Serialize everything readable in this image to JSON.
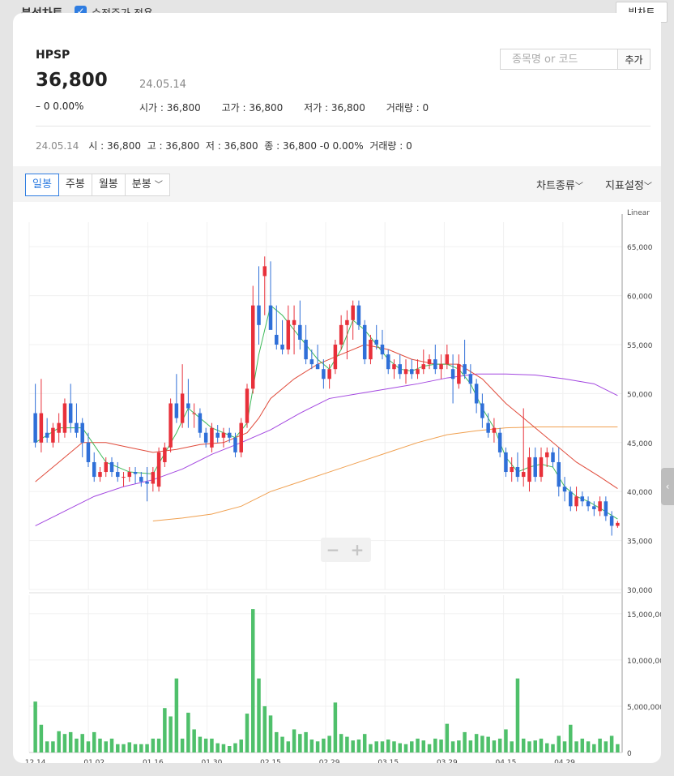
{
  "topbar": {
    "title": "분석차트",
    "adjusted_label": "수정주가 적용",
    "big_chart_btn": "빅차트"
  },
  "header": {
    "symbol": "HPSP",
    "price": "36,800",
    "date": "24.05.14",
    "change": "0",
    "change_pct": "0.00%",
    "open": "시가 : 36,800",
    "high": "고가 : 36,800",
    "low": "저가 : 36,800",
    "volume": "거래량 : 0",
    "search_placeholder": "종목명 or 코드",
    "add_label": "추가"
  },
  "ohlc_line": {
    "date": "24.05.14",
    "text": "시 : 36,800  고 : 36,800  저 : 36,800  종 : 36,800 -0 0.00%  거래량 : 0"
  },
  "toolbar": {
    "tabs": [
      "일봉",
      "주봉",
      "월봉",
      "분봉"
    ],
    "active_tab": 0,
    "chart_type": "차트종류",
    "indicator": "지표설정"
  },
  "colors": {
    "up": "#e8303a",
    "down": "#2f6fd8",
    "volume": "#4fc06b",
    "ma5": "#3fba5a",
    "ma20": "#e04a3a",
    "ma60": "#a347e0",
    "ma120": "#f0a050",
    "accent": "#2f7de1"
  },
  "chart_data": {
    "type": "candlestick",
    "scale_label": "Linear",
    "y_ticks": [
      30000,
      35000,
      40000,
      45000,
      50000,
      55000,
      60000,
      65000
    ],
    "ylim": [
      30000,
      67500
    ],
    "vol_ticks": [
      0,
      5000000,
      10000000,
      15000000
    ],
    "vol_max": 17000000,
    "x_labels": [
      "12.14",
      "01.02",
      "01.16",
      "01.30",
      "02.15",
      "02.29",
      "03.15",
      "03.29",
      "04.15",
      "04.29"
    ],
    "x_label_idx": [
      0,
      10,
      20,
      30,
      40,
      50,
      60,
      70,
      80,
      90
    ],
    "candles": [
      [
        48000,
        51000,
        44500,
        45000,
        5500000
      ],
      [
        45000,
        51500,
        44000,
        48000,
        3000000
      ],
      [
        46000,
        47500,
        45000,
        45500,
        1200000
      ],
      [
        45000,
        47000,
        44500,
        46500,
        1200000
      ],
      [
        46000,
        48000,
        45000,
        47000,
        2300000
      ],
      [
        46000,
        49500,
        45500,
        49000,
        2000000
      ],
      [
        49000,
        51000,
        46000,
        47000,
        2200000
      ],
      [
        47000,
        49000,
        45500,
        46000,
        1500000
      ],
      [
        47000,
        47500,
        43500,
        45000,
        2000000
      ],
      [
        45000,
        46000,
        42500,
        43000,
        1200000
      ],
      [
        43000,
        44000,
        41000,
        41500,
        2200000
      ],
      [
        41500,
        42500,
        41000,
        42000,
        1500000
      ],
      [
        42000,
        43500,
        41500,
        43000,
        1200000
      ],
      [
        43000,
        43500,
        41500,
        42000,
        1500000
      ],
      [
        42000,
        43000,
        41000,
        41500,
        900000
      ],
      [
        41500,
        42000,
        40500,
        41500,
        900000
      ],
      [
        41500,
        42500,
        41000,
        42000,
        1100000
      ],
      [
        42000,
        42500,
        40800,
        41800,
        900000
      ],
      [
        41500,
        42000,
        40500,
        41000,
        900000
      ],
      [
        41000,
        42500,
        39000,
        40800,
        900000
      ],
      [
        40800,
        42500,
        40000,
        42000,
        1500000
      ],
      [
        40500,
        44500,
        40000,
        44000,
        1500000
      ],
      [
        43000,
        45000,
        42500,
        44500,
        4800000
      ],
      [
        44500,
        49500,
        44000,
        49000,
        3900000
      ],
      [
        49000,
        52000,
        47000,
        47500,
        8000000
      ],
      [
        47000,
        53000,
        46500,
        50000,
        1500000
      ],
      [
        49000,
        51500,
        46500,
        48500,
        4300000
      ],
      [
        48000,
        49000,
        46500,
        48000,
        2500000
      ],
      [
        48000,
        48500,
        45500,
        46000,
        1700000
      ],
      [
        46000,
        46500,
        44500,
        45000,
        1500000
      ],
      [
        44500,
        47000,
        44000,
        46500,
        1500000
      ],
      [
        46000,
        46800,
        45000,
        45500,
        1000000
      ],
      [
        45500,
        46500,
        44500,
        46000,
        900000
      ],
      [
        46000,
        46500,
        45000,
        45500,
        700000
      ],
      [
        45500,
        46000,
        43500,
        44000,
        1000000
      ],
      [
        44000,
        47500,
        43500,
        47000,
        1400000
      ],
      [
        47000,
        51000,
        46500,
        50500,
        4200000
      ],
      [
        50500,
        61000,
        50000,
        59000,
        15500000
      ],
      [
        59000,
        63000,
        55000,
        57000,
        8000000
      ],
      [
        62000,
        64000,
        58000,
        63000,
        5000000
      ],
      [
        59000,
        63500,
        57000,
        56500,
        4000000
      ],
      [
        56000,
        59000,
        54500,
        55000,
        2200000
      ],
      [
        55000,
        57500,
        54000,
        54500,
        1700000
      ],
      [
        54500,
        59000,
        54000,
        57500,
        1200000
      ],
      [
        57000,
        59000,
        54000,
        57500,
        2500000
      ],
      [
        57000,
        59500,
        54500,
        55500,
        2000000
      ],
      [
        55500,
        57000,
        53000,
        53500,
        2200000
      ],
      [
        53500,
        54500,
        52500,
        53000,
        1400000
      ],
      [
        53000,
        55000,
        52500,
        52500,
        1200000
      ],
      [
        52500,
        53500,
        50500,
        51500,
        1500000
      ],
      [
        51500,
        53000,
        50500,
        52500,
        1800000
      ],
      [
        52500,
        55500,
        52000,
        55000,
        5400000
      ],
      [
        55000,
        58000,
        54500,
        57000,
        2000000
      ],
      [
        57000,
        58500,
        53500,
        57500,
        1700000
      ],
      [
        57500,
        59500,
        55500,
        59000,
        1300000
      ],
      [
        59000,
        59500,
        56500,
        57000,
        1400000
      ],
      [
        57000,
        57500,
        53000,
        53500,
        2000000
      ],
      [
        53500,
        56000,
        53000,
        55500,
        900000
      ],
      [
        55500,
        57000,
        54500,
        55000,
        1200000
      ],
      [
        55000,
        56500,
        53500,
        54000,
        1200000
      ],
      [
        54000,
        54500,
        52000,
        52500,
        1400000
      ],
      [
        52500,
        53500,
        51500,
        53000,
        1200000
      ],
      [
        53000,
        54000,
        51500,
        52000,
        1000000
      ],
      [
        52000,
        53500,
        51000,
        52500,
        900000
      ],
      [
        52500,
        53500,
        51500,
        52000,
        1200000
      ],
      [
        52000,
        53500,
        51500,
        52500,
        1500000
      ],
      [
        52500,
        54500,
        52000,
        53000,
        1300000
      ],
      [
        53000,
        54000,
        52500,
        53500,
        900000
      ],
      [
        53500,
        55000,
        52000,
        52500,
        1500000
      ],
      [
        52500,
        54000,
        51500,
        53000,
        1400000
      ],
      [
        53000,
        55000,
        52500,
        54000,
        3100000
      ],
      [
        52500,
        54000,
        49000,
        51500,
        1200000
      ],
      [
        51000,
        54000,
        50500,
        53000,
        1300000
      ],
      [
        53000,
        55500,
        51500,
        52000,
        2200000
      ],
      [
        52000,
        53000,
        50000,
        51000,
        1300000
      ],
      [
        51000,
        51500,
        48000,
        49000,
        2000000
      ],
      [
        49000,
        50000,
        46500,
        47500,
        1800000
      ],
      [
        47000,
        48000,
        45500,
        46000,
        1700000
      ],
      [
        46000,
        47500,
        45000,
        46500,
        1300000
      ],
      [
        46000,
        46500,
        43500,
        44000,
        1500000
      ],
      [
        44000,
        44500,
        41500,
        42000,
        2500000
      ],
      [
        42000,
        43500,
        41000,
        42500,
        1200000
      ],
      [
        42500,
        44000,
        41000,
        41500,
        8000000
      ],
      [
        41500,
        48500,
        40500,
        42000,
        1500000
      ],
      [
        41000,
        44500,
        40000,
        43500,
        1200000
      ],
      [
        43500,
        44500,
        41000,
        41500,
        1300000
      ],
      [
        41500,
        44500,
        41000,
        43500,
        1500000
      ],
      [
        43500,
        44500,
        42500,
        44000,
        1000000
      ],
      [
        44000,
        44500,
        42500,
        43000,
        900000
      ],
      [
        43000,
        44500,
        39500,
        40500,
        1800000
      ],
      [
        40500,
        41500,
        39000,
        40000,
        1200000
      ],
      [
        40000,
        40500,
        38000,
        38500,
        3000000
      ],
      [
        38500,
        40500,
        38000,
        39500,
        1200000
      ],
      [
        39500,
        40000,
        38500,
        39000,
        1500000
      ],
      [
        39000,
        39500,
        38000,
        38500,
        1200000
      ],
      [
        38500,
        39000,
        37500,
        38200,
        900000
      ],
      [
        38000,
        39500,
        37500,
        39000,
        1500000
      ],
      [
        39000,
        39500,
        37000,
        37500,
        1200000
      ],
      [
        37500,
        38000,
        35500,
        36500,
        1800000
      ],
      [
        36500,
        37000,
        36300,
        36800,
        900000
      ]
    ],
    "ma5": [
      [
        0,
        45000
      ],
      [
        4,
        46500
      ],
      [
        8,
        46500
      ],
      [
        12,
        43000
      ],
      [
        16,
        42000
      ],
      [
        20,
        41800
      ],
      [
        24,
        46000
      ],
      [
        26,
        48500
      ],
      [
        30,
        46500
      ],
      [
        34,
        45500
      ],
      [
        36,
        47000
      ],
      [
        38,
        54000
      ],
      [
        40,
        59000
      ],
      [
        42,
        58000
      ],
      [
        44,
        56500
      ],
      [
        46,
        55000
      ],
      [
        48,
        53500
      ],
      [
        50,
        52500
      ],
      [
        52,
        54500
      ],
      [
        54,
        57500
      ],
      [
        56,
        56500
      ],
      [
        58,
        55000
      ],
      [
        60,
        53500
      ],
      [
        62,
        52500
      ],
      [
        64,
        52300
      ],
      [
        66,
        52800
      ],
      [
        68,
        53000
      ],
      [
        70,
        53000
      ],
      [
        72,
        52500
      ],
      [
        74,
        51000
      ],
      [
        76,
        48500
      ],
      [
        78,
        46500
      ],
      [
        80,
        43500
      ],
      [
        82,
        42000
      ],
      [
        84,
        42500
      ],
      [
        86,
        42800
      ],
      [
        88,
        42500
      ],
      [
        90,
        40500
      ],
      [
        92,
        39500
      ],
      [
        94,
        39000
      ],
      [
        96,
        38300
      ],
      [
        99,
        37200
      ]
    ],
    "ma20": [
      [
        0,
        41000
      ],
      [
        4,
        43000
      ],
      [
        8,
        45000
      ],
      [
        12,
        45000
      ],
      [
        16,
        44500
      ],
      [
        20,
        44000
      ],
      [
        24,
        44300
      ],
      [
        28,
        44800
      ],
      [
        32,
        45000
      ],
      [
        36,
        46000
      ],
      [
        38,
        47500
      ],
      [
        40,
        49500
      ],
      [
        44,
        51500
      ],
      [
        48,
        53000
      ],
      [
        52,
        54000
      ],
      [
        56,
        55000
      ],
      [
        60,
        54500
      ],
      [
        64,
        53500
      ],
      [
        68,
        53000
      ],
      [
        72,
        53000
      ],
      [
        76,
        51500
      ],
      [
        80,
        49000
      ],
      [
        84,
        47000
      ],
      [
        88,
        45000
      ],
      [
        92,
        43000
      ],
      [
        96,
        41500
      ],
      [
        99,
        40300
      ]
    ],
    "ma60": [
      [
        0,
        36500
      ],
      [
        5,
        38000
      ],
      [
        10,
        39500
      ],
      [
        15,
        40500
      ],
      [
        20,
        41200
      ],
      [
        25,
        42300
      ],
      [
        30,
        43800
      ],
      [
        35,
        45000
      ],
      [
        40,
        46300
      ],
      [
        45,
        48000
      ],
      [
        50,
        49500
      ],
      [
        55,
        50000
      ],
      [
        60,
        50500
      ],
      [
        65,
        51000
      ],
      [
        70,
        51600
      ],
      [
        75,
        52000
      ],
      [
        80,
        52000
      ],
      [
        85,
        51900
      ],
      [
        90,
        51500
      ],
      [
        95,
        51000
      ],
      [
        99,
        49800
      ]
    ],
    "ma120": [
      [
        20,
        37000
      ],
      [
        25,
        37300
      ],
      [
        30,
        37700
      ],
      [
        35,
        38500
      ],
      [
        40,
        40000
      ],
      [
        45,
        41000
      ],
      [
        50,
        42000
      ],
      [
        55,
        43000
      ],
      [
        60,
        44000
      ],
      [
        65,
        45000
      ],
      [
        70,
        45800
      ],
      [
        75,
        46200
      ],
      [
        80,
        46500
      ],
      [
        85,
        46600
      ],
      [
        90,
        46600
      ],
      [
        95,
        46600
      ],
      [
        99,
        46600
      ]
    ]
  }
}
